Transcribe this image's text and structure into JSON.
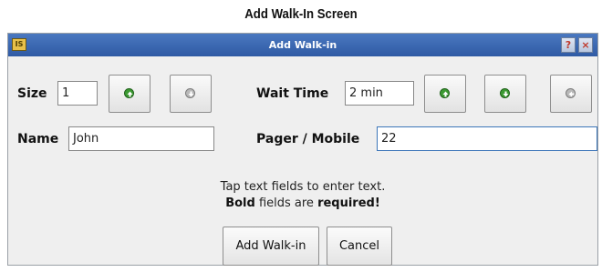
{
  "caption": "Add Walk-In Screen",
  "window": {
    "title": "Add Walk-in",
    "app_icon_text": "IS",
    "help_label": "?",
    "close_label": "×"
  },
  "form": {
    "size_label": "Size",
    "size_value": "1",
    "wait_label": "Wait Time",
    "wait_value": "2 min",
    "name_label": "Name",
    "name_value": "John",
    "pager_label": "Pager / Mobile",
    "pager_value": "22"
  },
  "icons": {
    "size_increase": "green-arrow-up-icon",
    "size_decrease": "grey-arrow-down-icon",
    "wait_increase": "green-arrow-up-icon",
    "wait_decrease": "green-arrow-down-icon",
    "wait_clear": "grey-arrow-left-icon"
  },
  "help": {
    "line1": "Tap text fields to enter text.",
    "line2_bold1": "Bold",
    "line2_mid": " fields are ",
    "line2_bold2": "required!"
  },
  "buttons": {
    "add": "Add Walk-in",
    "cancel": "Cancel"
  },
  "colors": {
    "titlebar": "#3a66b0",
    "accent_green": "#3c9a32",
    "focus_border": "#3d76b9"
  }
}
